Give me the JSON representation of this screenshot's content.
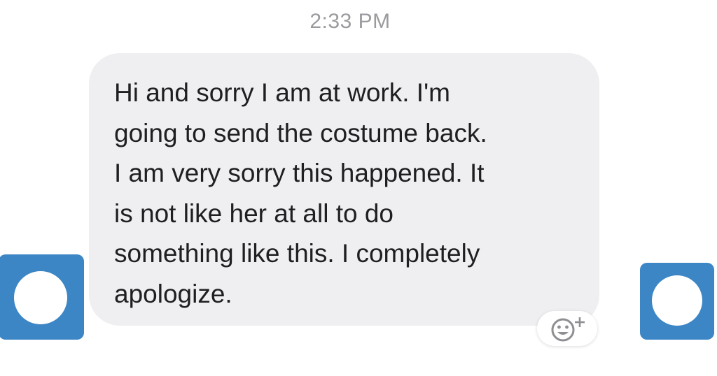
{
  "timestamp": "2:33 PM",
  "message": {
    "lines": [
      "Hi and sorry I am at work. I'm",
      "going to send the costume back.",
      "I am very sorry this happened. It",
      "is not like her at all to do",
      "something like this. I completely",
      "apologize."
    ]
  },
  "icons": {
    "left_avatar": "avatar-icon",
    "right_avatar": "avatar-icon",
    "reaction": "add-reaction-icon"
  },
  "colors": {
    "bubble": "#efeff1",
    "text": "#1f1f21",
    "timestamp": "#9a9a9f",
    "avatar": "#3d86c6"
  }
}
